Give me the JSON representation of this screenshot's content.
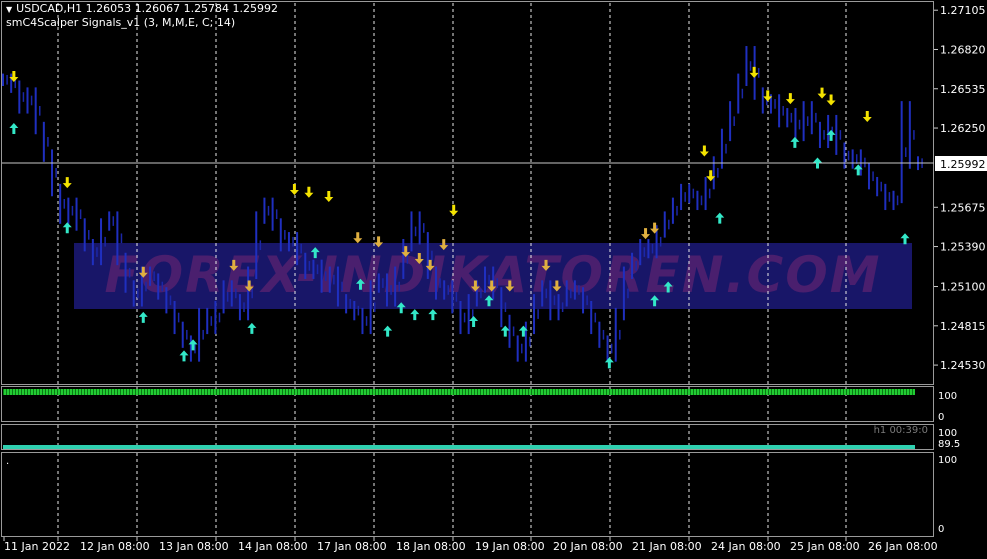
{
  "header": {
    "symbol_line": "USDCAD,H1  1.26053 1.26067 1.25784 1.25992",
    "indicator_line": "smC4Scalper Signals_v1 (3, M,M,E, C; 14)"
  },
  "watermark": "FOREX-INDIKATOREN.COM",
  "price_axis": {
    "ticks": [
      "1.27105",
      "1.26820",
      "1.26535",
      "1.26250",
      "1.25675",
      "1.25390",
      "1.25100",
      "1.24815",
      "1.24530"
    ],
    "current_price": "1.25992",
    "current_price_hidden": "1.25960"
  },
  "time_axis": {
    "labels": [
      "11 Jan 2022",
      "12 Jan 08:00",
      "13 Jan 08:00",
      "14 Jan 08:00",
      "17 Jan 08:00",
      "18 Jan 08:00",
      "19 Jan 08:00",
      "20 Jan 08:00",
      "21 Jan 08:00",
      "24 Jan 08:00",
      "25 Jan 08:00",
      "26 Jan 08:00"
    ]
  },
  "subwindows": {
    "sub1": {
      "top": "100",
      "bottom": "0"
    },
    "sub2": {
      "top": "100",
      "mid": "89.5",
      "timer": "h1  00:39:0"
    },
    "sub3": {
      "top": "100",
      "bottom": "0",
      "dot": "."
    }
  },
  "colors": {
    "background": "#000000",
    "price_bars": "#1f2fbf",
    "grid": "#ffffff",
    "sell_arrow": "#f4e300",
    "sell_arrow_alt": "#e0b040",
    "buy_arrow": "#33e8c8",
    "histogram": "#22cc33",
    "watermark_fill": "#1c1a7a",
    "watermark_text": "#5a1f7a"
  },
  "chart_data": {
    "type": "line",
    "title": "",
    "xlabel": "",
    "ylabel": "",
    "ylim": [
      1.244,
      1.2715
    ],
    "series": [
      {
        "values": [
          1.266,
          1.2655,
          1.264,
          1.265,
          1.2625,
          1.2605,
          1.258,
          1.256,
          1.257,
          1.2555,
          1.254,
          1.253,
          1.2555,
          1.256,
          1.253,
          1.251,
          1.25,
          1.252,
          1.2515,
          1.2505,
          1.2495,
          1.248,
          1.247,
          1.246,
          1.249,
          1.248,
          1.2495,
          1.251,
          1.25,
          1.249,
          1.252,
          1.256,
          1.257,
          1.2555,
          1.254,
          1.2545,
          1.253,
          1.252,
          1.2525,
          1.251,
          1.252,
          1.25,
          1.2495,
          1.249,
          1.248,
          1.251,
          1.2515,
          1.25,
          1.252,
          1.254,
          1.256,
          1.2545,
          1.252,
          1.2505,
          1.251,
          1.2495,
          1.248,
          1.25,
          1.251,
          1.252,
          1.2505,
          1.2485,
          1.247,
          1.246,
          1.248,
          1.25,
          1.251,
          1.249,
          1.25,
          1.251,
          1.2505,
          1.2495,
          1.248,
          1.247,
          1.246,
          1.249,
          1.252,
          1.253,
          1.254,
          1.2535,
          1.255,
          1.256,
          1.257,
          1.258,
          1.2575,
          1.257,
          1.2585,
          1.26,
          1.262,
          1.264,
          1.266,
          1.268,
          1.265,
          1.264,
          1.2645,
          1.263,
          1.2635,
          1.262,
          1.264,
          1.2625,
          1.2615,
          1.263,
          1.261,
          1.26,
          1.2605,
          1.2595,
          1.2585,
          1.258,
          1.257,
          1.2575,
          1.264,
          1.26,
          1.2599
        ]
      }
    ],
    "sell_arrows": [
      [
        0.012,
        1.2662
      ],
      [
        0.071,
        1.2585
      ],
      [
        0.155,
        1.252
      ],
      [
        0.255,
        1.2525
      ],
      [
        0.272,
        1.251
      ],
      [
        0.322,
        1.258
      ],
      [
        0.338,
        1.2578
      ],
      [
        0.36,
        1.2575
      ],
      [
        0.392,
        1.2545
      ],
      [
        0.415,
        1.2542
      ],
      [
        0.445,
        1.2535
      ],
      [
        0.46,
        1.253
      ],
      [
        0.472,
        1.2525
      ],
      [
        0.487,
        1.254
      ],
      [
        0.498,
        1.2565
      ],
      [
        0.522,
        1.251
      ],
      [
        0.54,
        1.251
      ],
      [
        0.56,
        1.251
      ],
      [
        0.6,
        1.2525
      ],
      [
        0.612,
        1.251
      ],
      [
        0.71,
        1.2548
      ],
      [
        0.72,
        1.2552
      ],
      [
        0.775,
        1.2608
      ],
      [
        0.782,
        1.259
      ],
      [
        0.83,
        1.2665
      ],
      [
        0.845,
        1.2648
      ],
      [
        0.87,
        1.2646
      ],
      [
        0.905,
        1.265
      ],
      [
        0.915,
        1.2645
      ],
      [
        0.955,
        1.2633
      ]
    ],
    "buy_arrows": [
      [
        0.012,
        1.2625
      ],
      [
        0.071,
        1.2553
      ],
      [
        0.155,
        1.2488
      ],
      [
        0.2,
        1.246
      ],
      [
        0.21,
        1.2468
      ],
      [
        0.275,
        1.248
      ],
      [
        0.345,
        1.2535
      ],
      [
        0.395,
        1.2512
      ],
      [
        0.425,
        1.2478
      ],
      [
        0.44,
        1.2495
      ],
      [
        0.455,
        1.249
      ],
      [
        0.475,
        1.249
      ],
      [
        0.52,
        1.2485
      ],
      [
        0.537,
        1.25
      ],
      [
        0.555,
        1.2478
      ],
      [
        0.575,
        1.2478
      ],
      [
        0.67,
        1.2455
      ],
      [
        0.72,
        1.25
      ],
      [
        0.735,
        1.251
      ],
      [
        0.792,
        1.256
      ],
      [
        0.875,
        1.2615
      ],
      [
        0.9,
        1.26
      ],
      [
        0.915,
        1.262
      ],
      [
        0.945,
        1.2595
      ],
      [
        1.002,
        1.2545
      ]
    ]
  }
}
